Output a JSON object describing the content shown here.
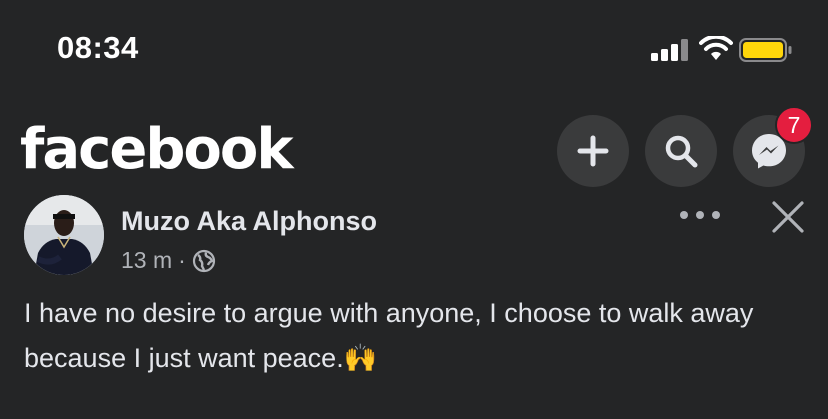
{
  "status_bar": {
    "time": "08:34",
    "icons": [
      "signal-icon",
      "wifi-icon",
      "battery-icon"
    ],
    "battery_color": "#ffd60a"
  },
  "header": {
    "logo": "facebook",
    "buttons": [
      {
        "icon": "plus-icon",
        "label": "Create"
      },
      {
        "icon": "search-icon",
        "label": "Search"
      },
      {
        "icon": "messenger-icon",
        "label": "Messenger",
        "badge": "7"
      }
    ],
    "badge_color": "#e41e3f"
  },
  "post": {
    "author": "Muzo Aka Alphonso",
    "time": "13 m",
    "separator": "·",
    "audience_icon": "globe-icon",
    "text": "I have no desire to argue with anyone, I choose to walk away because I just want peace.🙌",
    "actions": [
      "more-icon",
      "close-icon"
    ]
  }
}
